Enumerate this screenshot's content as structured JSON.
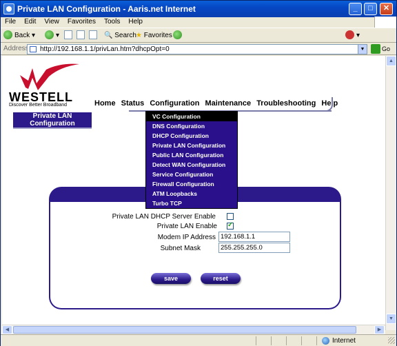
{
  "window": {
    "title": "Private LAN Configuration - Aaris.net Internet"
  },
  "menu": [
    "File",
    "Edit",
    "View",
    "Favorites",
    "Tools",
    "Help"
  ],
  "toolbar": {
    "back": "Back",
    "search": "Search",
    "favorites": "Favorites"
  },
  "address": {
    "label": "Address",
    "url": "http://192.168.1.1/privLan.htm?dhcpOpt=0",
    "go": "Go"
  },
  "logo": {
    "brand": "WESTELL",
    "tagline": "Discover Better Broadband"
  },
  "nav": [
    "Home",
    "Status",
    "Configuration",
    "Maintenance",
    "Troubleshooting",
    "Help"
  ],
  "sidebar": {
    "title": "Private LAN Configuration"
  },
  "dropdown": [
    "VC Configuration",
    "DNS Configuration",
    "DHCP Configuration",
    "Private LAN Configuration",
    "Public LAN Configuration",
    "Detect WAN Configuration",
    "Service Configuration",
    "Firewall Configuration",
    "ATM Loopbacks",
    "Turbo TCP"
  ],
  "form": {
    "dhcp_label": "Private LAN DHCP Server Enable",
    "dhcp_checked": false,
    "lan_label": "Private LAN Enable",
    "lan_checked": true,
    "ip_label": "Modem IP Address",
    "ip_value": "192.168.1.1",
    "mask_label": "Subnet Mask",
    "mask_value": "255.255.255.0",
    "save": "save",
    "reset": "reset"
  },
  "status": {
    "zone": "Internet"
  }
}
